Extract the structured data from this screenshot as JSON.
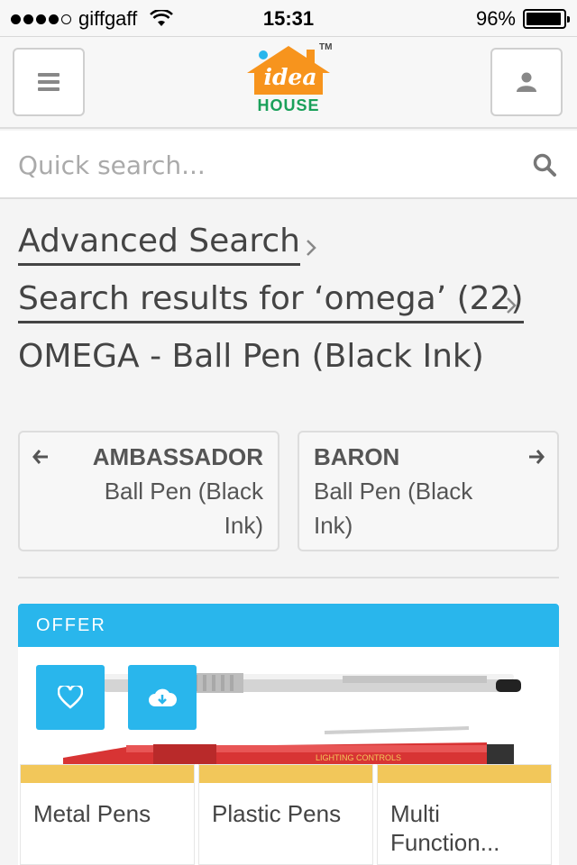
{
  "status_bar": {
    "carrier": "giffgaff",
    "time": "15:31",
    "battery": "96%",
    "battery_level": 0.96
  },
  "header": {
    "logo_text": "idea",
    "logo_subtext": "HOUSE",
    "logo_tm": "TM"
  },
  "search": {
    "placeholder": "Quick search..."
  },
  "breadcrumbs": [
    {
      "label": "Advanced Search"
    },
    {
      "label": "Search results for ‘omega’ (22)"
    },
    {
      "label": "OMEGA - Ball Pen (Black Ink)"
    }
  ],
  "product_nav": {
    "prev": {
      "title": "AMBASSADOR",
      "subtitle": "Ball Pen (Black Ink)"
    },
    "next": {
      "title": "BARON",
      "subtitle": "Ball Pen (Black Ink)"
    }
  },
  "offer": {
    "label": "OFFER",
    "pen_print": "LIGHTING CONTROLS",
    "categories": [
      "Metal Pens",
      "Plastic Pens",
      "Multi Function..."
    ]
  },
  "colors": {
    "accent": "#29b6ec",
    "tile_band": "#f2c75a",
    "logo_orange": "#f7941d",
    "logo_green": "#1aa05a"
  }
}
